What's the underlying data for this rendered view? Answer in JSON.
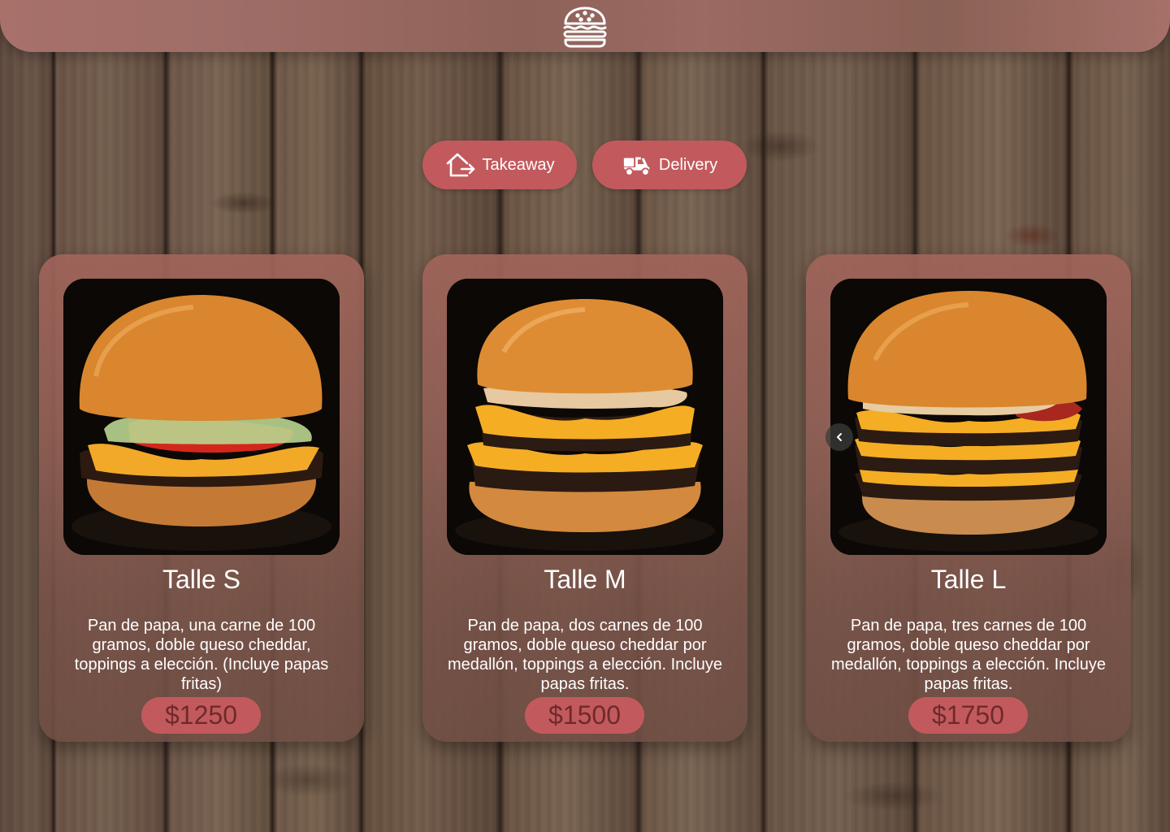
{
  "header": {
    "logo_icon": "burger-icon",
    "bar_color": "#a8716a"
  },
  "order_options": [
    {
      "label": "Takeaway",
      "icon": "house-arrow-icon"
    },
    {
      "label": "Delivery",
      "icon": "scooter-icon"
    }
  ],
  "products": [
    {
      "title": "Talle S",
      "description": "Pan de papa, una carne de 100 gramos, doble queso cheddar, toppings a elección. (Incluye papas fritas)",
      "price": "$1250"
    },
    {
      "title": "Talle M",
      "description": "Pan de papa, dos carnes de 100 gramos, doble queso cheddar por medallón, toppings a elección. Incluye papas fritas.",
      "price": "$1500"
    },
    {
      "title": "Talle L",
      "description": "Pan de papa, tres carnes de 100 gramos, doble queso cheddar por medallón, toppings a elección. Incluye papas fritas.",
      "price": "$1750"
    }
  ],
  "carousel": {
    "prev_icon": "chevron-left-icon"
  },
  "colors": {
    "accent": "#c25a5d",
    "price_text": "#6e2a2c",
    "card": "#9a6258"
  }
}
